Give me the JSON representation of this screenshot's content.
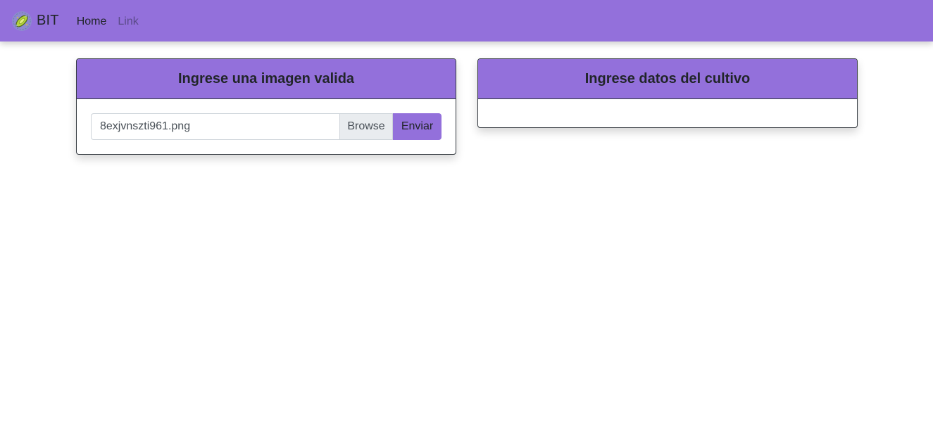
{
  "navbar": {
    "brand": "BIT",
    "logo_icon": "bacteria-logo-icon",
    "links": [
      {
        "label": "Home",
        "active": true
      },
      {
        "label": "Link",
        "active": false
      }
    ],
    "color": "#9370db"
  },
  "image_card": {
    "title": "Ingrese una imagen valida",
    "file_name": "8exjvnszti961.png",
    "browse_label": "Browse",
    "submit_label": "Enviar"
  },
  "crop_card": {
    "title": "Ingrese datos del cultivo"
  },
  "colors": {
    "accent": "#9370db",
    "border": "#343a40",
    "input_border": "#ced4da",
    "browse_bg": "#e9ecef"
  }
}
